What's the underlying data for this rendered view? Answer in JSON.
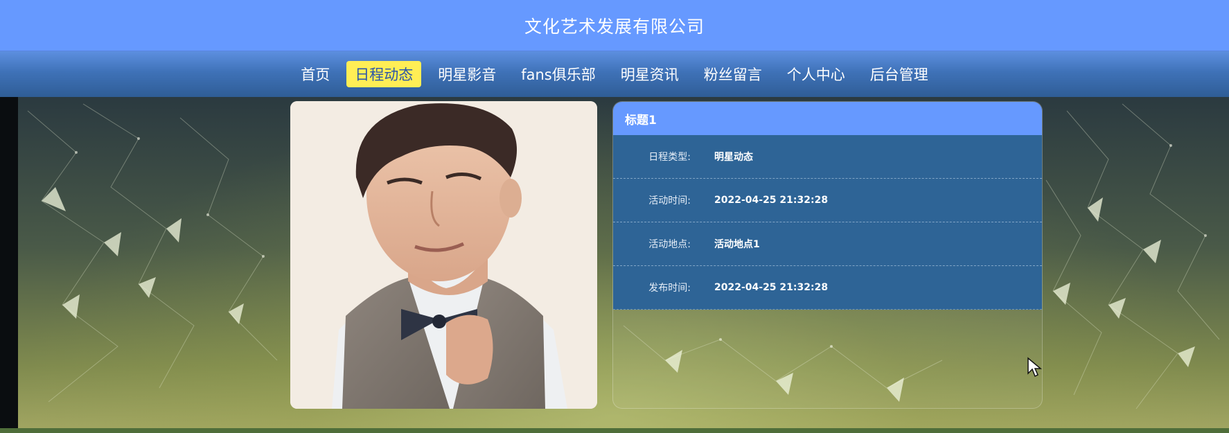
{
  "header": {
    "title": "文化艺术发展有限公司"
  },
  "nav": {
    "items": [
      {
        "label": "首页",
        "active": false
      },
      {
        "label": "日程动态",
        "active": true
      },
      {
        "label": "明星影音",
        "active": false
      },
      {
        "label": "fans俱乐部",
        "active": false
      },
      {
        "label": "明星资讯",
        "active": false
      },
      {
        "label": "粉丝留言",
        "active": false
      },
      {
        "label": "个人中心",
        "active": false
      },
      {
        "label": "后台管理",
        "active": false
      }
    ]
  },
  "detail": {
    "title": "标题1",
    "rows": [
      {
        "label": "日程类型:",
        "value": "明星动态"
      },
      {
        "label": "活动时间:",
        "value": "2022-04-25 21:32:28"
      },
      {
        "label": "活动地点:",
        "value": "活动地点1"
      },
      {
        "label": "发布时间:",
        "value": "2022-04-25 21:32:28"
      }
    ]
  },
  "colors": {
    "header_bg": "#6699ff",
    "nav_active_bg": "#ffee55",
    "table_bg": "#2e6496"
  },
  "icons": {
    "cursor": "mouse-pointer-icon"
  }
}
